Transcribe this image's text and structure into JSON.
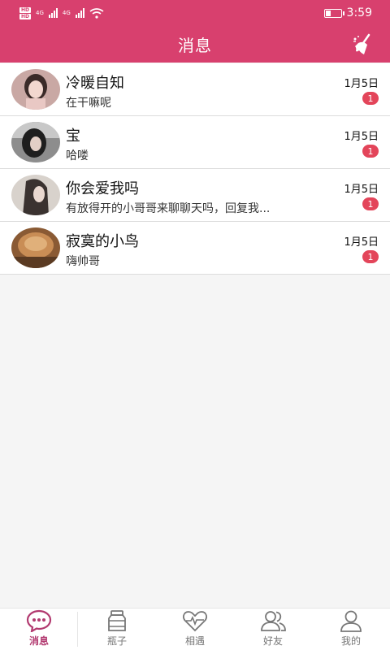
{
  "statusbar": {
    "network_1": "4G",
    "network_2": "4G",
    "time": "3:59",
    "battery_level": 0.3
  },
  "header": {
    "title": "消息"
  },
  "conversations": [
    {
      "name": "冷暖自知",
      "preview": "在干嘛呢",
      "date": "1月5日",
      "unread": "1"
    },
    {
      "name": "宝",
      "preview": "哈喽",
      "date": "1月5日",
      "unread": "1"
    },
    {
      "name": "你会爱我吗",
      "preview": "有放得开的小哥哥来聊聊天吗，回复我...",
      "date": "1月5日",
      "unread": "1"
    },
    {
      "name": "寂寞的小鸟",
      "preview": "嗨帅哥",
      "date": "1月5日",
      "unread": "1"
    }
  ],
  "tabbar": {
    "tabs": [
      {
        "label": "消息",
        "icon": "chat-bubble-icon",
        "active": true
      },
      {
        "label": "瓶子",
        "icon": "bottle-icon",
        "active": false
      },
      {
        "label": "相遇",
        "icon": "heart-pulse-icon",
        "active": false
      },
      {
        "label": "好友",
        "icon": "friends-icon",
        "active": false
      },
      {
        "label": "我的",
        "icon": "person-icon",
        "active": false
      }
    ]
  },
  "colors": {
    "brand": "#d8406e",
    "badge": "#e3455a",
    "active_tab": "#b23a70"
  }
}
